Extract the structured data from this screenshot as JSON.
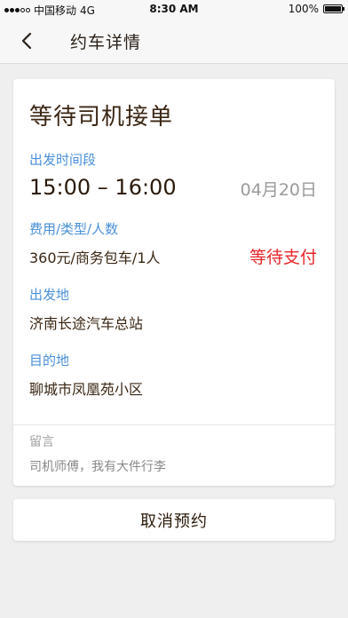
{
  "status_bar": {
    "carrier": "中国移动",
    "network": "4G",
    "time": "8:30 AM",
    "battery": "100%",
    "battery_level": 1.0
  },
  "nav": {
    "title": "约车详情",
    "back_icon": "chevron-left-icon"
  },
  "order": {
    "status": "等待司机接单",
    "time_label": "出发时间段",
    "time_range": "15:00 – 16:00",
    "date": "04月20日",
    "fee_label": "费用/类型/人数",
    "fee_value": "360元/商务包车/1人",
    "payment_status": "等待支付",
    "departure_label": "出发地",
    "departure_value": "济南长途汽车总站",
    "destination_label": "目的地",
    "destination_value": "聊城市凤凰苑小区",
    "message_label": "留言",
    "message_text": "司机师傅，我有大件行李"
  },
  "actions": {
    "cancel_label": "取消预约"
  },
  "colors": {
    "label_blue": "#4a90d9",
    "alert_red": "#e8262a",
    "text_brown": "#3a2613",
    "background": "#efeff0"
  }
}
